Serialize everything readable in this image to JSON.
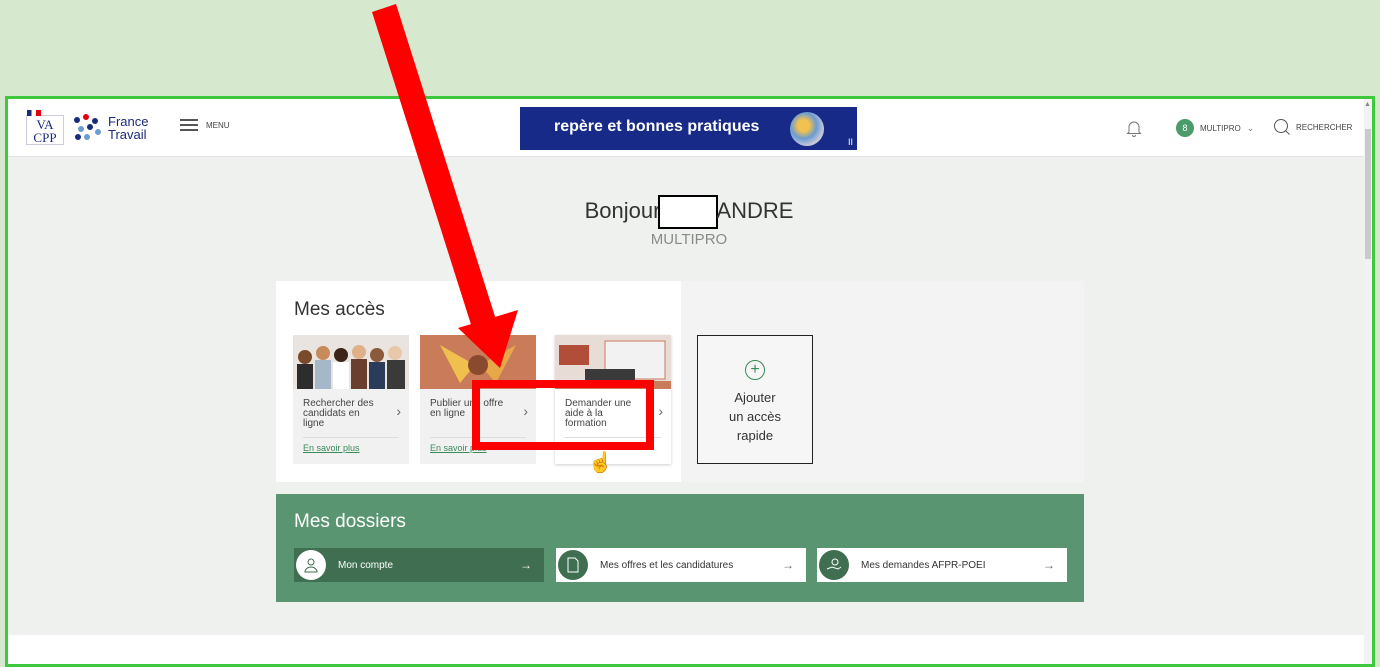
{
  "header": {
    "logo_vacpp": "VA CPP",
    "logo_ft": "France Travail",
    "menu_label": "MENU",
    "banner_text": "repère et bonnes pratiques",
    "banner_pause": "II",
    "account_initial": "8",
    "account_name": "MULTIPRO",
    "search_label": "RECHERCHER"
  },
  "greeting": {
    "hello": "Bonjour",
    "surname": "ANDRE",
    "company": "MULTIPRO"
  },
  "access": {
    "title": "Mes accès",
    "tiles": [
      {
        "label": "Rechercher des candidats en ligne",
        "more": "En savoir plus"
      },
      {
        "label": "Publier une offre en ligne",
        "more": "En savoir plus"
      },
      {
        "label": "Demander une aide à la formation",
        "more": ""
      }
    ],
    "add_label_1": "Ajouter",
    "add_label_2": "un accès",
    "add_label_3": "rapide"
  },
  "dossiers": {
    "title": "Mes dossiers",
    "items": [
      {
        "label": "Mon compte"
      },
      {
        "label": "Mes offres et les candidatures"
      },
      {
        "label": "Mes demandes AFPR-POEI"
      }
    ]
  },
  "colors": {
    "green_dark": "#3f6f50",
    "green": "#5a9571",
    "annotation": "#ff0000",
    "frame": "#3ec83e"
  }
}
